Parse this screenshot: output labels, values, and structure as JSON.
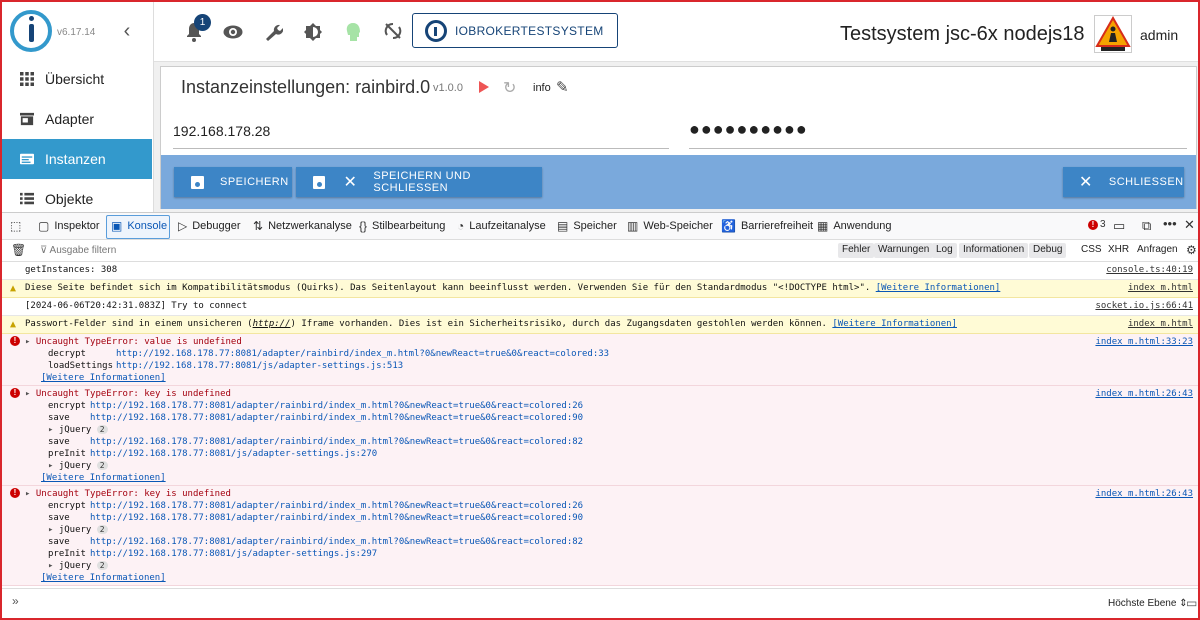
{
  "sidebar": {
    "version": "v6.17.14",
    "items": [
      {
        "label": "Übersicht",
        "active": false
      },
      {
        "label": "Adapter",
        "active": false
      },
      {
        "label": "Instanzen",
        "active": true
      },
      {
        "label": "Objekte",
        "active": false
      }
    ]
  },
  "topbar": {
    "notification_count": "1",
    "host_button": "IOBROKERTESTSYSTEM",
    "system_title": "Testsystem jsc-6x nodejs18",
    "user": "admin"
  },
  "instance": {
    "title": "Instanzeinstellungen: rainbird.0",
    "version": "v1.0.0",
    "info_label": "info",
    "ip_value": "192.168.178.28",
    "password_value": "●●●●●●●●●●",
    "save_label": "SPEICHERN",
    "save_close_label": "SPEICHERN UND SCHLIESSEN",
    "close_label": "SCHLIESSEN"
  },
  "devtools": {
    "tabs": [
      "Inspektor",
      "Konsole",
      "Debugger",
      "Netzwerkanalyse",
      "Stilbearbeitung",
      "Laufzeitanalyse",
      "Speicher",
      "Web-Speicher",
      "Barrierefreiheit",
      "Anwendung"
    ],
    "error_count": "3",
    "filter_placeholder": "Ausgabe filtern",
    "filter_buttons": [
      "Fehler",
      "Warnungen",
      "Log",
      "Informationen",
      "Debug"
    ],
    "extra_buttons": [
      "CSS",
      "XHR",
      "Anfragen"
    ],
    "context_select": "Höchste Ebene"
  },
  "console": {
    "rows": [
      {
        "type": "log",
        "message": "getInstances: 308",
        "source": "console.ts:40:19"
      },
      {
        "type": "warn",
        "message": "Diese Seite befindet sich im Kompatibilitätsmodus (Quirks). Das Seitenlayout kann beeinflusst werden. Verwenden Sie für den Standardmodus \"<!DOCTYPE html>\".",
        "more": "[Weitere Informationen]",
        "source": "index_m.html"
      },
      {
        "type": "log",
        "message": "[2024-06-06T20:42:31.083Z] Try to connect",
        "source": "socket.io.js:66:41"
      },
      {
        "type": "warn",
        "message_pre": "Passwort-Felder sind in einem unsicheren (",
        "message_em": "http://",
        "message_post": ") Iframe vorhanden. Dies ist ein Sicherheitsrisiko, durch das Zugangsdaten gestohlen werden können.",
        "more": "[Weitere Informationen]",
        "source": "index_m.html"
      }
    ],
    "errors": [
      {
        "title": "Uncaught TypeError: value is undefined",
        "source": "index_m.html:33:23",
        "stack": [
          {
            "fn": "decrypt",
            "url": "http://192.168.178.77:8081/adapter/rainbird/index_m.html?0&newReact=true&0&react=colored:33"
          },
          {
            "fn": "loadSettings",
            "url": "http://192.168.178.77:8081/js/adapter-settings.js:513"
          }
        ],
        "more": "[Weitere Informationen]"
      },
      {
        "title": "Uncaught TypeError: key is undefined",
        "source": "index_m.html:26:43",
        "stack": [
          {
            "fn": "encrypt",
            "url": "http://192.168.178.77:8081/adapter/rainbird/index_m.html?0&newReact=true&0&react=colored:26"
          },
          {
            "fn": "save",
            "url": "http://192.168.178.77:8081/adapter/rainbird/index_m.html?0&newReact=true&0&react=colored:90"
          },
          {
            "fn": "jQuery",
            "badge": "2"
          },
          {
            "fn": "save",
            "url": "http://192.168.178.77:8081/adapter/rainbird/index_m.html?0&newReact=true&0&react=colored:82"
          },
          {
            "fn": "preInit",
            "url": "http://192.168.178.77:8081/js/adapter-settings.js:270"
          },
          {
            "fn": "jQuery",
            "badge": "2"
          }
        ],
        "more": "[Weitere Informationen]"
      },
      {
        "title": "Uncaught TypeError: key is undefined",
        "source": "index_m.html:26:43",
        "stack": [
          {
            "fn": "encrypt",
            "url": "http://192.168.178.77:8081/adapter/rainbird/index_m.html?0&newReact=true&0&react=colored:26"
          },
          {
            "fn": "save",
            "url": "http://192.168.178.77:8081/adapter/rainbird/index_m.html?0&newReact=true&0&react=colored:90"
          },
          {
            "fn": "jQuery",
            "badge": "2"
          },
          {
            "fn": "save",
            "url": "http://192.168.178.77:8081/adapter/rainbird/index_m.html?0&newReact=true&0&react=colored:82"
          },
          {
            "fn": "preInit",
            "url": "http://192.168.178.77:8081/js/adapter-settings.js:297"
          },
          {
            "fn": "jQuery",
            "badge": "2"
          }
        ],
        "more": "[Weitere Informationen]"
      }
    ]
  },
  "colors": {
    "brand": "#164477",
    "accent": "#3399cc",
    "error": "#cc0000",
    "warning_bg": "#fffbd6"
  }
}
